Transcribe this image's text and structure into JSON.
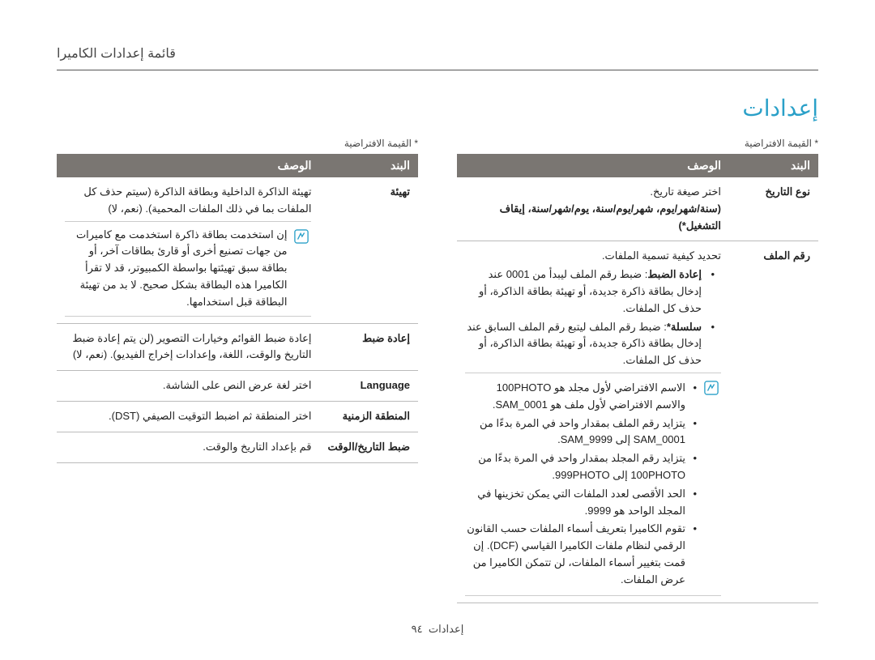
{
  "breadcrumb": "قائمة إعدادات الكاميرا",
  "section_title": "إعدادات",
  "default_note": "* القيمة الافتراضية",
  "headers": {
    "item": "البند",
    "desc": "الوصف"
  },
  "right": {
    "rows": [
      {
        "item": "تهيئة",
        "desc_plain": "تهيئة الذاكرة الداخلية وبطاقة الذاكرة (سيتم حذف كل الملفات بما في ذلك الملفات المحمية). (نعم، لا)",
        "note": "إن استخدمت بطاقة ذاكرة استخدمت مع كاميرات من جهات تصنيع أخرى أو قارئ بطاقات آخر، أو بطاقة سبق تهيئتها بواسطة الكمبيوتر، قد لا تقرأ الكاميرا هذه البطاقة بشكل صحيح. لا بد من تهيئة البطاقة قبل استخدامها."
      },
      {
        "item": "إعادة ضبط",
        "desc_plain": "إعادة ضبط القوائم وخيارات التصوير (لن يتم إعادة ضبط التاريخ والوقت، اللغة، وإعدادات إخراج الفيديو). (نعم، لا)"
      },
      {
        "item": "Language",
        "desc_plain": "اختر لغة عرض النص على الشاشة."
      },
      {
        "item": "المنطقة الزمنية",
        "desc_plain": "اختر المنطقة ثم اضبط التوقيت الصيفي (DST)."
      },
      {
        "item": "ضبط التاريخ/الوقت",
        "desc_plain": "قم بإعداد التاريخ والوقت."
      }
    ]
  },
  "left": {
    "rows": [
      {
        "item": "نوع التاريخ",
        "desc_lead": "اختر صيغة تاريخ.",
        "desc_options": "(سنة/شهر/يوم، شهر/يوم/سنة، يوم/شهر/سنة، إيقاف التشغيل*)"
      },
      {
        "item": "رقم الملف",
        "desc_lead": "تحديد كيفية تسمية الملفات.",
        "bullets": [
          {
            "label": "إعادة الضبط",
            "text": ": ضبط رقم الملف ليبدأ من 0001 عند إدخال بطاقة ذاكرة جديدة، أو تهيئة بطاقة الذاكرة، أو حذف كل الملفات."
          },
          {
            "label": "سلسلة*",
            "text": ": ضبط رقم الملف ليتبع رقم الملف السابق عند إدخال بطاقة ذاكرة جديدة، أو تهيئة بطاقة الذاكرة، أو حذف كل الملفات."
          }
        ],
        "note_lines": [
          "الاسم الافتراضي لأول مجلد هو 100PHOTO والاسم الافتراضي لأول ملف هو SAM_0001.",
          "يتزايد رقم الملف بمقدار واحد في المرة بدءًا من SAM_0001 إلى SAM_9999.",
          "يتزايد رقم المجلد بمقدار واحد في المرة بدءًا من 100PHOTO إلى 999PHOTO.",
          "الحد الأقصى لعدد الملفات التي يمكن تخزينها في المجلد الواحد هو 9999.",
          "تقوم الكاميرا بتعريف أسماء الملفات حسب القانون الرقمي لنظام ملفات الكاميرا القياسي (DCF). إن قمت بتغيير أسماء الملفات، لن تتمكن الكاميرا من عرض الملفات."
        ]
      }
    ]
  },
  "footer": {
    "label": "إعدادات",
    "page": "٩٤"
  }
}
